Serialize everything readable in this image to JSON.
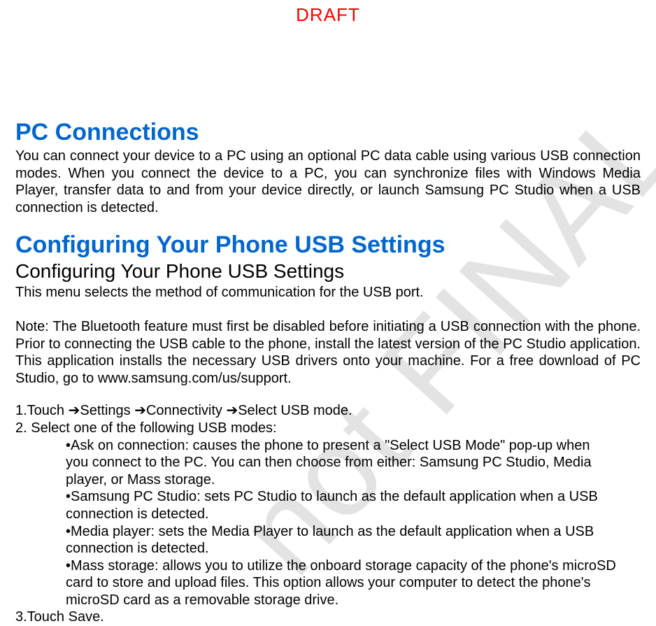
{
  "draft": "DRAFT",
  "watermark": "not FINAL",
  "heading1": "PC Connections",
  "intro": "You can connect your device to a PC using an optional PC data cable using various USB connection modes. When you connect the device to a PC, you can synchronize files with Windows Media Player, transfer data to and from your device directly, or launch Samsung PC Studio when a USB connection is detected.",
  "heading2": "Configuring Your Phone USB Settings",
  "subheading": "Configuring Your Phone USB Settings",
  "menu_desc": "This menu selects the method of communication for the USB port.",
  "note": "Note: The Bluetooth feature must first be disabled before initiating a USB connection with the phone. Prior to connecting the USB cable to the phone, install the latest version of the PC Studio application. This application installs the necessary USB drivers onto your machine. For a free download of PC Studio, go to www.samsung.com/us/support.",
  "step1_prefix": "1.Touch   ",
  "step1_path": "➔Settings ➔Connectivity ➔Select USB mode.",
  "step2": "2. Select one of the following USB modes:",
  "bullet1_l1": "•Ask on connection: causes the phone to present a \"Select USB Mode\" pop-up when",
  "bullet1_l2": "  you connect to the PC. You can then choose from either: Samsung PC Studio, Media",
  "bullet1_l3": "player, or Mass storage.",
  "bullet2_l1": "•Samsung PC Studio: sets PC Studio to launch as the default application when a USB",
  "bullet2_l2": "connection is detected.",
  "bullet3_l1": "•Media player: sets the Media Player to launch as the default application when a USB",
  "bullet3_l2": "connection is detected.",
  "bullet4_l1": "•Mass storage: allows you to utilize the onboard storage capacity of the phone's microSD",
  "bullet4_l2": "card to store and upload files. This option allows your computer to detect the phone's",
  "bullet4_l3": "microSD card as a removable storage drive.",
  "step3": "3.Touch Save."
}
